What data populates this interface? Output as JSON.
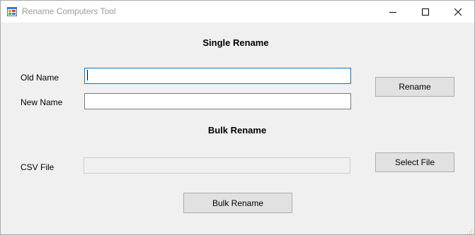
{
  "window": {
    "title": "Rename Computers Tool",
    "icon": "app-window-icon",
    "controls": [
      "minimize-icon",
      "maximize-icon",
      "close-icon"
    ]
  },
  "single_rename": {
    "heading": "Single Rename",
    "old_name_label": "Old Name",
    "old_name_value": "",
    "new_name_label": "New Name",
    "new_name_value": "",
    "rename_button": "Rename"
  },
  "bulk_rename": {
    "heading": "Bulk Rename",
    "csv_label": "CSV File",
    "csv_value": "",
    "select_file_button": "Select File",
    "bulk_rename_button": "Bulk Rename"
  },
  "colors": {
    "form_background": "#f0f0f0",
    "focus_border": "#0078d7",
    "button_face": "#e1e1e1"
  }
}
